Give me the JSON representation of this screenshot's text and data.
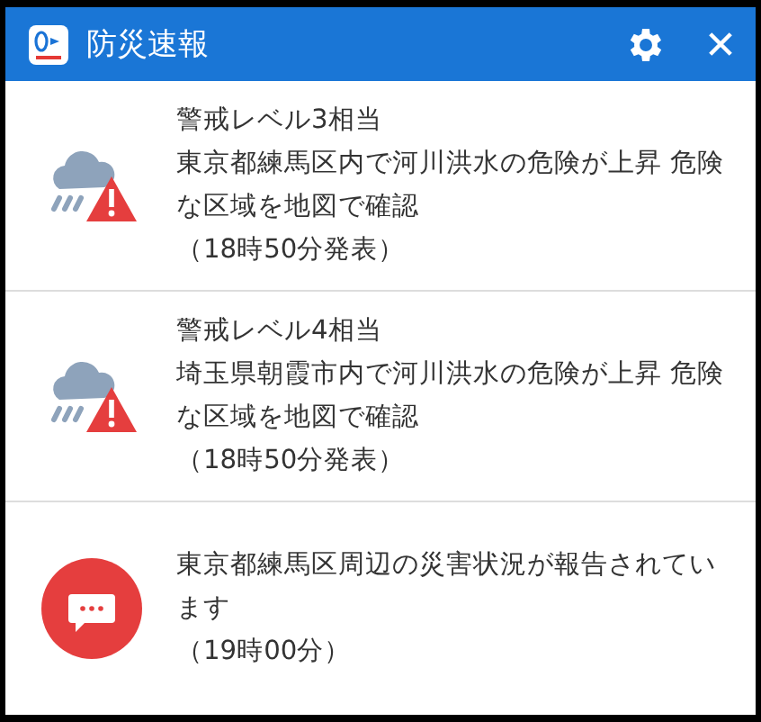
{
  "window": {
    "title": "防災速報"
  },
  "notifications": [
    {
      "kind": "warning",
      "title": "警戒レベル3相当",
      "message": "東京都練馬区内で河川洪水の危険が上昇 危険な区域を地図で確認",
      "time": "（18時50分発表）"
    },
    {
      "kind": "warning",
      "title": "警戒レベル4相当",
      "message": "埼玉県朝霞市内で河川洪水の危険が上昇 危険な区域を地図で確認",
      "time": "（18時50分発表）"
    },
    {
      "kind": "report",
      "message": "東京都練馬区周辺の災害状況が報告されています",
      "time": "（19時00分）"
    }
  ]
}
